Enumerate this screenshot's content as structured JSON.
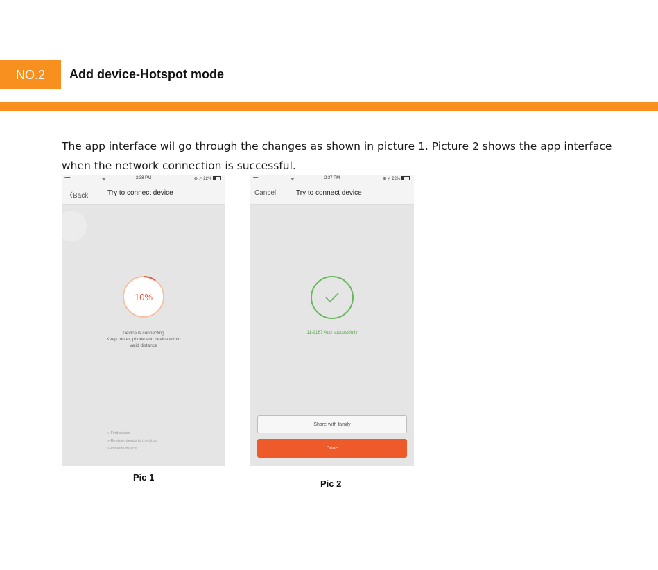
{
  "header": {
    "badge": "NO.2",
    "title": "Add device-Hotspot mode",
    "accent_color": "#f7901e"
  },
  "intro": "The app interface wil go through the changes as shown in picture 1. Picture 2 shows the app interface when the network connection is successful.",
  "pic1": {
    "status": {
      "signal": "•••••",
      "wifi": "ᯤ",
      "time": "2:38 PM",
      "battery": "⊕ ➚ 22%"
    },
    "nav": {
      "back": "〈Back",
      "title": "Try to connect device"
    },
    "progress": "10%",
    "progress_fraction": 0.1,
    "message_lines": [
      "Device is connecting",
      "Keep router, phone and device within",
      "valid distance"
    ],
    "steps": [
      "» Find device",
      "» Register device to the cloud",
      "» Initialize device"
    ],
    "caption": "Pic 1"
  },
  "pic2": {
    "status": {
      "signal": "••••◦",
      "wifi": "ᯤ",
      "time": "2:37 PM",
      "battery": "⊕ ➚ 22%"
    },
    "nav": {
      "cancel": "Cancel",
      "title": "Try to connect device"
    },
    "success_text": "11-2167 Add successfully",
    "share_button": "Share with family",
    "done_button": "Done",
    "caption": "Pic 2"
  }
}
